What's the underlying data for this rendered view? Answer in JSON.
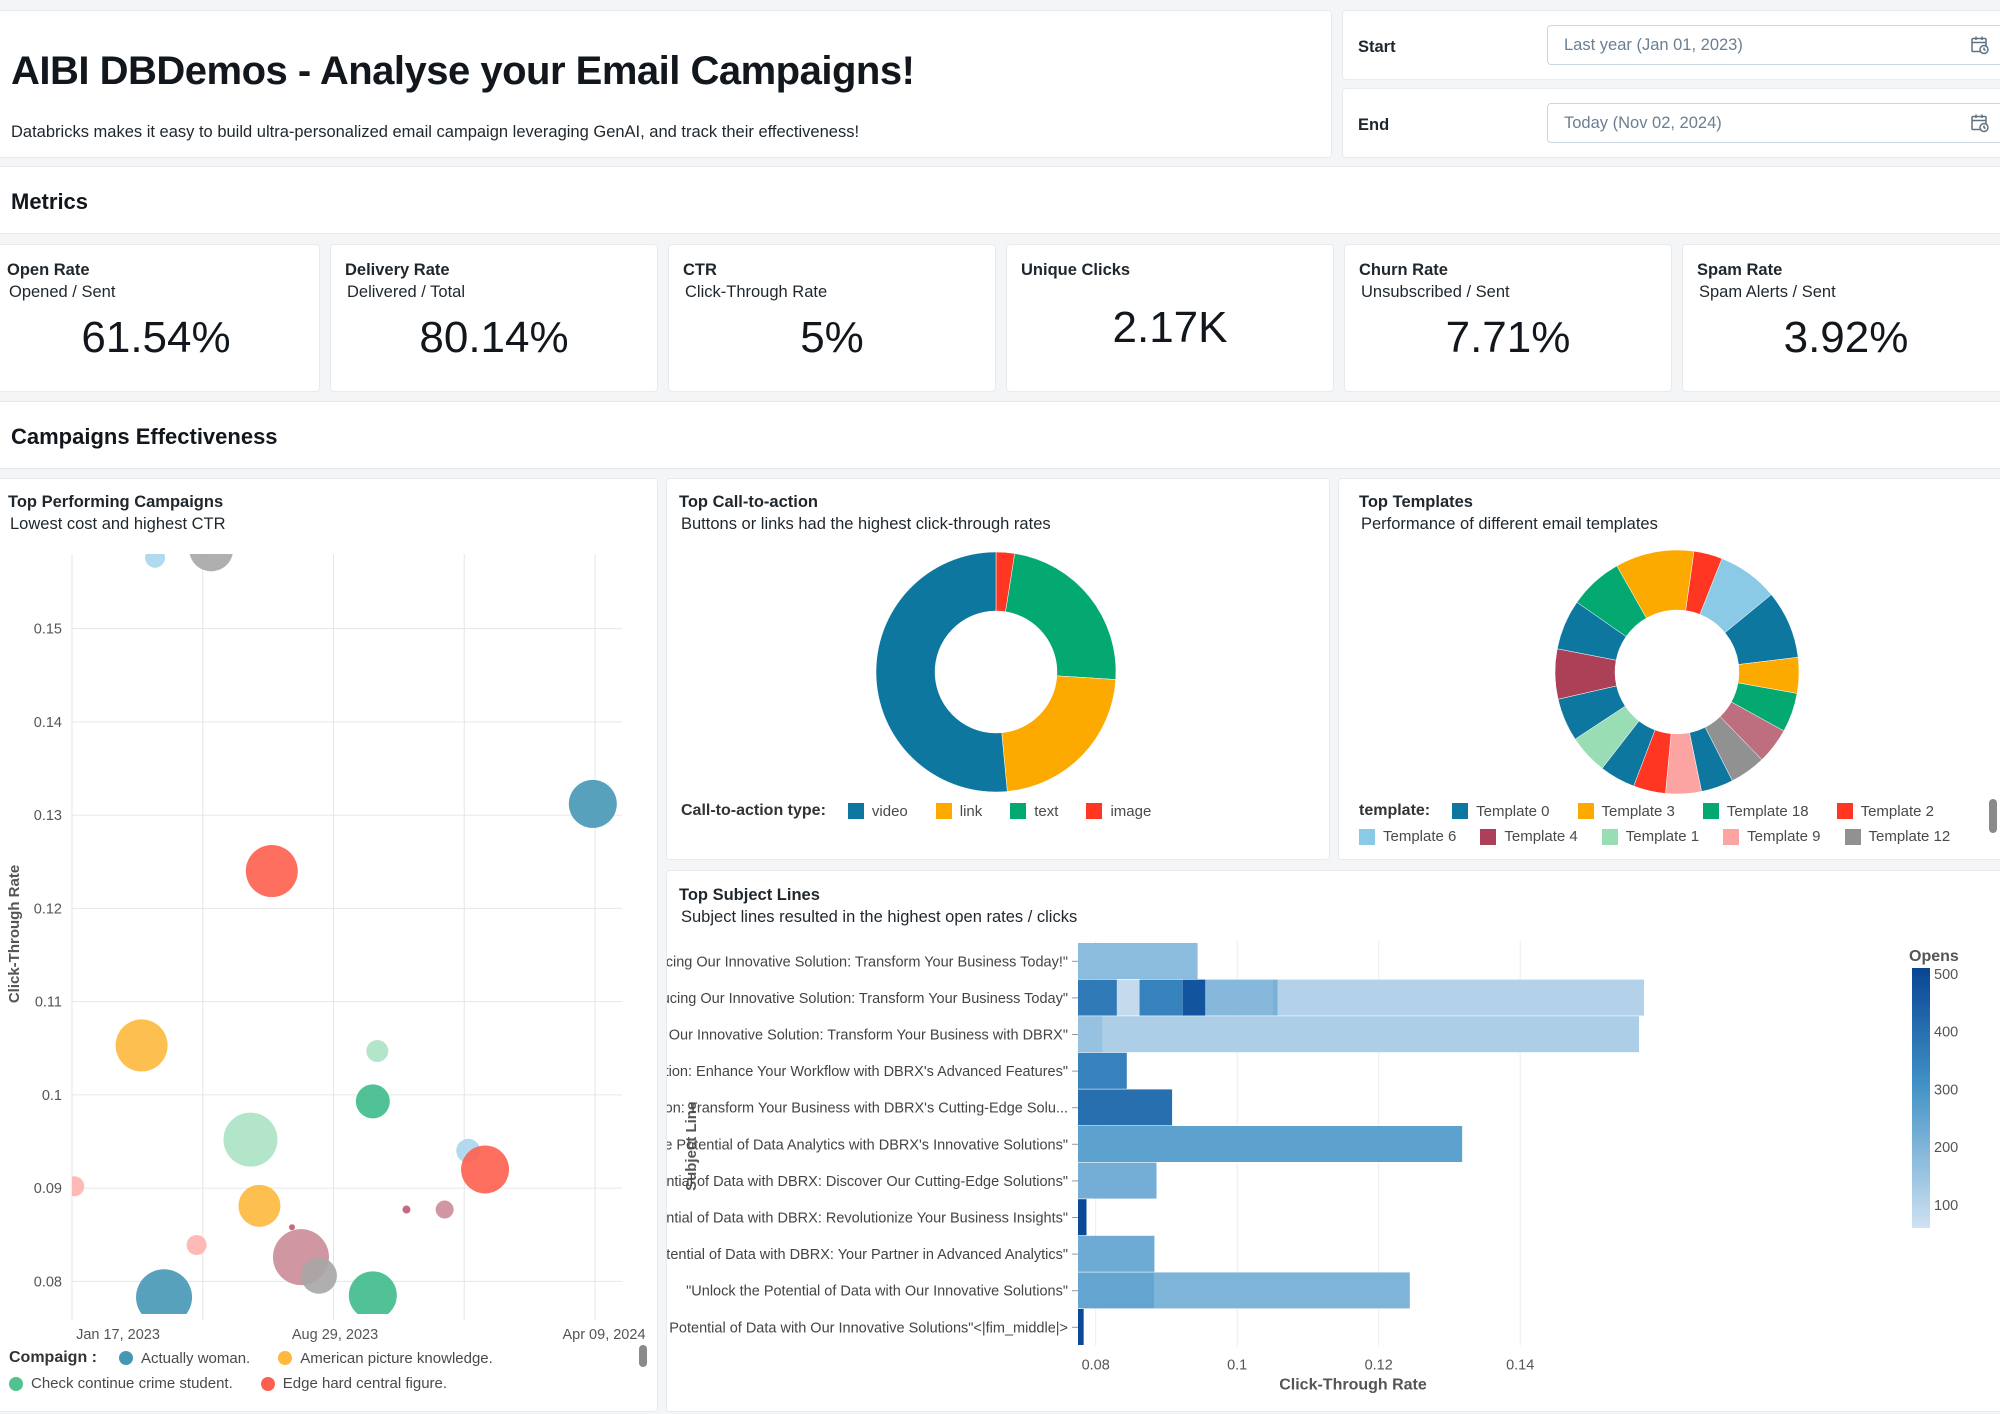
{
  "header": {
    "title": "AIBI DBDemos - Analyse your Email Campaigns!",
    "description": "Databricks makes it easy to build ultra-personalized email campaign leveraging GenAI, and track their effectiveness!"
  },
  "filters": {
    "start": {
      "label": "Start",
      "placeholder": "Last year (Jan 01, 2023)",
      "icon": "calendar-clock-icon"
    },
    "end": {
      "label": "End",
      "placeholder": "Today (Nov 02, 2024)",
      "icon": "calendar-clock-icon"
    }
  },
  "sections": {
    "metrics": "Metrics",
    "campaigns": "Campaigns Effectiveness"
  },
  "kpis": [
    {
      "title": "Open Rate",
      "subtitle": "Opened / Sent",
      "value": "61.54%"
    },
    {
      "title": "Delivery Rate",
      "subtitle": "Delivered / Total",
      "value": "80.14%"
    },
    {
      "title": "CTR",
      "subtitle": "Click-Through Rate",
      "value": "5%"
    },
    {
      "title": "Unique Clicks",
      "subtitle": "",
      "value": "2.17K"
    },
    {
      "title": "Churn Rate",
      "subtitle": "Unsubscribed / Sent",
      "value": "7.71%"
    },
    {
      "title": "Spam Rate",
      "subtitle": "Spam Alerts / Sent",
      "value": "3.92%"
    }
  ],
  "panels": {
    "scatter": {
      "title": "Top Performing Campaigns",
      "subtitle": "Lowest cost and highest CTR"
    },
    "cta": {
      "title": "Top Call-to-action",
      "subtitle": "Buttons or links had the highest click-through rates"
    },
    "templates": {
      "title": "Top Templates",
      "subtitle": "Performance of different email templates"
    },
    "subjects": {
      "title": "Top Subject Lines",
      "subtitle": "Subject lines resulted in the highest open rates / clicks"
    }
  },
  "chart_data": [
    {
      "type": "scatter",
      "title": "Top Performing Campaigns",
      "xlabel": "",
      "ylabel": "Click-Through Rate",
      "x_ticks": [
        "Jan 17, 2023",
        "Aug 29, 2023",
        "Apr 09, 2024"
      ],
      "x_range_days": [
        0,
        490
      ],
      "ylim": [
        0.0765,
        0.158
      ],
      "y_ticks": [
        0.08,
        0.09,
        0.1,
        0.11,
        0.12,
        0.13,
        0.14,
        0.15
      ],
      "grid": true,
      "legend_title": "Compaign :",
      "legend": [
        {
          "name": "Actually woman.",
          "color": "#4597b5"
        },
        {
          "name": "American picture knowledge.",
          "color": "#fdb83d"
        },
        {
          "name": "Check continue crime student.",
          "color": "#4fc28f"
        },
        {
          "name": "Edge hard central figure.",
          "color": "#ff5f4f"
        }
      ],
      "points": [
        {
          "day": 74,
          "ctr": 0.1576,
          "size": 10,
          "color": "#a9d6ed"
        },
        {
          "day": 124,
          "ctr": 0.1585,
          "size": 22,
          "color": "#a6a6a6"
        },
        {
          "day": 2,
          "ctr": 0.0902,
          "size": 10,
          "color": "#ffb3b0"
        },
        {
          "day": 178,
          "ctr": 0.124,
          "size": 26,
          "color": "#ff5f4f"
        },
        {
          "day": 464,
          "ctr": 0.1312,
          "size": 24,
          "color": "#4597b5"
        },
        {
          "day": 62,
          "ctr": 0.1053,
          "size": 26,
          "color": "#fdb83d"
        },
        {
          "day": 159,
          "ctr": 0.0952,
          "size": 27,
          "color": "#abe2c5"
        },
        {
          "day": 272,
          "ctr": 0.1047,
          "size": 11,
          "color": "#abe2c5"
        },
        {
          "day": 268,
          "ctr": 0.0993,
          "size": 17,
          "color": "#3dbb8a"
        },
        {
          "day": 167,
          "ctr": 0.0881,
          "size": 21,
          "color": "#fdb83d"
        },
        {
          "day": 111,
          "ctr": 0.0839,
          "size": 10,
          "color": "#ffb3b0"
        },
        {
          "day": 196,
          "ctr": 0.0858,
          "size": 3,
          "color": "#c05a74"
        },
        {
          "day": 204,
          "ctr": 0.0826,
          "size": 28,
          "color": "#cb8b97"
        },
        {
          "day": 220,
          "ctr": 0.0806,
          "size": 18,
          "color": "#a6a6a6"
        },
        {
          "day": 268,
          "ctr": 0.0785,
          "size": 24,
          "color": "#3dbb8a"
        },
        {
          "day": 82,
          "ctr": 0.0783,
          "size": 28,
          "color": "#4597b5"
        },
        {
          "day": 298,
          "ctr": 0.0877,
          "size": 4,
          "color": "#c05a74"
        },
        {
          "day": 332,
          "ctr": 0.0877,
          "size": 9,
          "color": "#cb8b97"
        },
        {
          "day": 353,
          "ctr": 0.094,
          "size": 12,
          "color": "#a9d6ed"
        },
        {
          "day": 368,
          "ctr": 0.092,
          "size": 24,
          "color": "#ff5f4f"
        }
      ]
    },
    {
      "type": "pie",
      "title": "Top Call-to-action",
      "legend_title": "Call-to-action type:",
      "donut": true,
      "slices": [
        {
          "label": "video",
          "value": 51.5,
          "color": "#0d77a0"
        },
        {
          "label": "link",
          "value": 22.5,
          "color": "#fdaa00"
        },
        {
          "label": "text",
          "value": 23.5,
          "color": "#04a871"
        },
        {
          "label": "image",
          "value": 2.5,
          "color": "#ff3621"
        }
      ],
      "slice_order_clockwise_from_top": [
        "image",
        "text",
        "link",
        "video"
      ]
    },
    {
      "type": "pie",
      "title": "Top Templates",
      "legend_title": "template:",
      "donut": true,
      "legend": [
        {
          "label": "Template 0",
          "color": "#0d77a0"
        },
        {
          "label": "Template 3",
          "color": "#fdaa00"
        },
        {
          "label": "Template 18",
          "color": "#04a871"
        },
        {
          "label": "Template 2",
          "color": "#ff3621"
        },
        {
          "label": "Template 6",
          "color": "#8bcae7"
        },
        {
          "label": "Template 4",
          "color": "#ab4057"
        },
        {
          "label": "Template 1",
          "color": "#99ddb4"
        },
        {
          "label": "Template 9",
          "color": "#fca4a1"
        },
        {
          "label": "Template 12",
          "color": "#919191"
        }
      ],
      "slices": [
        {
          "value": 4.0,
          "color": "#ff3621"
        },
        {
          "value": 8.5,
          "color": "#8bcae7"
        },
        {
          "value": 9.5,
          "color": "#0d77a0"
        },
        {
          "value": 5.0,
          "color": "#fdaa00"
        },
        {
          "value": 5.5,
          "color": "#04a871"
        },
        {
          "value": 5.0,
          "color": "#be6f7f"
        },
        {
          "value": 5.0,
          "color": "#919191"
        },
        {
          "value": 4.5,
          "color": "#0d77a0"
        },
        {
          "value": 5.0,
          "color": "#fca4a1"
        },
        {
          "value": 4.5,
          "color": "#ff3621"
        },
        {
          "value": 5.0,
          "color": "#0d77a0"
        },
        {
          "value": 5.5,
          "color": "#99ddb4"
        },
        {
          "value": 6.0,
          "color": "#0d77a0"
        },
        {
          "value": 7.0,
          "color": "#ab4057"
        },
        {
          "value": 7.0,
          "color": "#0d77a0"
        },
        {
          "value": 7.5,
          "color": "#04a871"
        },
        {
          "value": 11.0,
          "color": "#fdaa00"
        }
      ]
    },
    {
      "type": "bar",
      "orientation": "horizontal",
      "title": "Top Subject Lines",
      "xlabel": "Click-Through Rate",
      "ylabel": "Subject Line",
      "xlim": [
        0.0775,
        0.1575
      ],
      "x_ticks": [
        0.08,
        0.1,
        0.12,
        0.14
      ],
      "grid": true,
      "color_legend": {
        "title": "Opens",
        "range": [
          60,
          510
        ],
        "ticks": [
          500,
          400,
          300,
          200,
          100
        ]
      },
      "categories": [
        "\"Introducing Our Innovative Solution: Transform Your Business Today!\"",
        "\"Introducing Our Innovative Solution: Transform Your Business Today\"",
        "\"Introducing Our Innovative Solution: Transform Your Business with DBRX\"",
        "\"Introducing Our Latest Innovation: Enhance Your Workflow with DBRX's Advanced Features\"",
        "\"Introducing Our Latest Innovation: Transform Your Business with DBRX's Cutting-Edge Solu...",
        "\"Unlock the Potential of Data Analytics with DBRX's Innovative Solutions\"",
        "\"Unlock the Potential of Data with DBRX: Discover Our Cutting-Edge Solutions\"",
        "\"Unlock the Potential of Data with DBRX: Revolutionize Your Business Insights\"",
        "\"Unlock the Potential of Data with DBRX: Your Partner in Advanced Analytics\"",
        "\"Unlock the Potential of Data with Our Innovative Solutions\"",
        "\"Unlock the Potential of Data with Our Innovative Solutions\"<|fim_middle|>"
      ],
      "segments": [
        [
          {
            "x0": 0.0775,
            "x1": 0.0944,
            "opens": 180
          }
        ],
        [
          {
            "x0": 0.0775,
            "x1": 0.083,
            "opens": 370
          },
          {
            "x0": 0.083,
            "x1": 0.0862,
            "opens": 80
          },
          {
            "x0": 0.0862,
            "x1": 0.0923,
            "opens": 350
          },
          {
            "x0": 0.0923,
            "x1": 0.0955,
            "opens": 470
          },
          {
            "x0": 0.0955,
            "x1": 0.105,
            "opens": 190
          },
          {
            "x0": 0.105,
            "x1": 0.1057,
            "opens": 210
          },
          {
            "x0": 0.1057,
            "x1": 0.1575,
            "opens": 110
          }
        ],
        [
          {
            "x0": 0.0775,
            "x1": 0.081,
            "opens": 160
          },
          {
            "x0": 0.081,
            "x1": 0.1568,
            "opens": 120
          }
        ],
        [
          {
            "x0": 0.0775,
            "x1": 0.0844,
            "opens": 350
          }
        ],
        [
          {
            "x0": 0.0775,
            "x1": 0.0908,
            "opens": 400
          }
        ],
        [
          {
            "x0": 0.0775,
            "x1": 0.1318,
            "opens": 260
          }
        ],
        [
          {
            "x0": 0.0775,
            "x1": 0.0886,
            "opens": 220
          }
        ],
        [
          {
            "x0": 0.0775,
            "x1": 0.0787,
            "opens": 500
          }
        ],
        [
          {
            "x0": 0.0775,
            "x1": 0.0883,
            "opens": 230
          }
        ],
        [
          {
            "x0": 0.0775,
            "x1": 0.0883,
            "opens": 250
          },
          {
            "x0": 0.0883,
            "x1": 0.1244,
            "opens": 200
          }
        ],
        [
          {
            "x0": 0.0775,
            "x1": 0.0783,
            "opens": 500
          }
        ]
      ]
    }
  ]
}
